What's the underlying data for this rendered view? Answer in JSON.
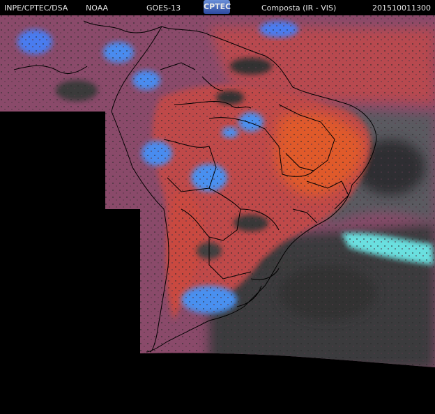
{
  "header": {
    "agency": "INPE/CPTEC/DSA",
    "source": "NOAA",
    "satellite": "GOES-13",
    "logo_text": "CPTEC",
    "product": "Composta (IR - VIS)",
    "timestamp": "201510011300"
  },
  "colors": {
    "background": "#000000",
    "land_clear": "#b84848",
    "hot_surface": "#e05a2a",
    "high_cloud": "#4a8cf0",
    "low_cloud": "#8a8a8a",
    "ocean_dark": "#2e2e2e",
    "borders": "#000000"
  }
}
